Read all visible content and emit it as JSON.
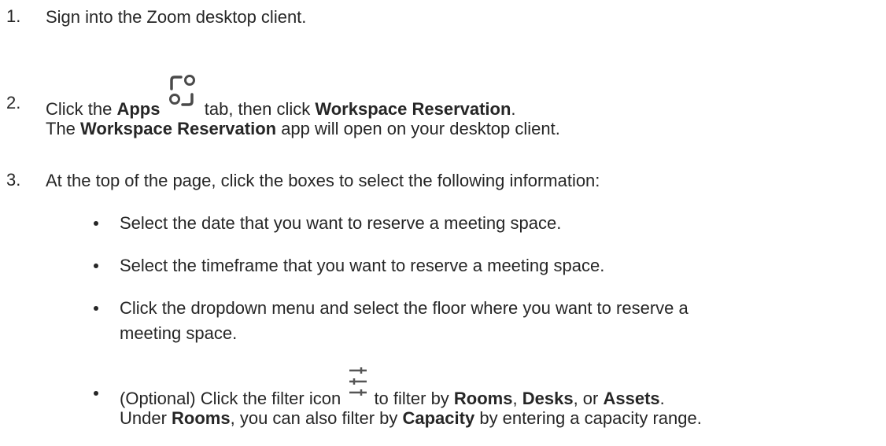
{
  "steps": [
    {
      "number": "1.",
      "text": "Sign into the Zoom desktop client."
    },
    {
      "number": "2.",
      "line1": {
        "t1": "Click the ",
        "b1": "Apps",
        "t2": " tab, then click ",
        "b2": "Workspace Reservation",
        "t3": "."
      },
      "line2": {
        "t1": "The ",
        "b1": "Workspace Reservation",
        "t2": " app will open on your desktop client."
      },
      "icon": "apps-icon"
    },
    {
      "number": "3.",
      "text": "At the top of the page, click the boxes to select the following information:",
      "bullets": [
        {
          "text": "Select the date that you want to reserve a meeting space."
        },
        {
          "text": "Select the timeframe that you want to reserve a meeting space."
        },
        {
          "line1": "Click the dropdown menu and select the floor where you want to reserve a",
          "line2": "meeting space."
        },
        {
          "line1": {
            "t1": "(Optional) Click the filter icon ",
            "t2": " to filter by ",
            "b1": "Rooms",
            "t3": ", ",
            "b2": "Desks",
            "t4": ", or ",
            "b3": "Assets",
            "t5": "."
          },
          "line2": {
            "t1": "Under ",
            "b1": "Rooms",
            "t2": ", you can also filter by ",
            "b2": "Capacity",
            "t3": " by entering a capacity range."
          },
          "icon": "filter-icon"
        }
      ]
    }
  ]
}
